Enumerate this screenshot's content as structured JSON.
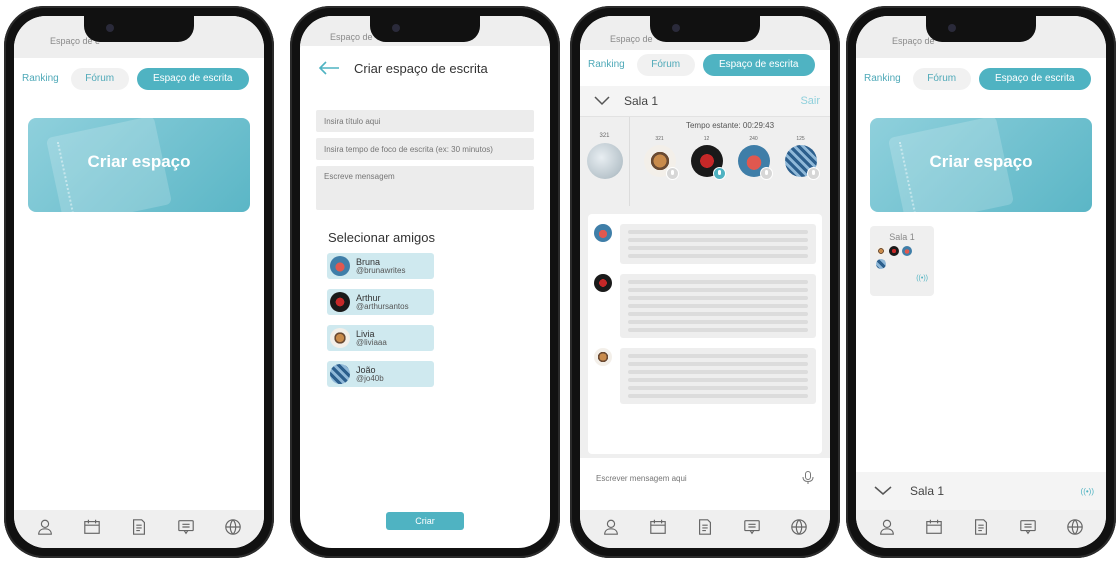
{
  "status": {
    "carrier_text": "Espaço de e",
    "carrier_text_short": "Espaço de"
  },
  "tabs": {
    "ranking": "Ranking",
    "forum": "Fórum",
    "writing_space": "Espaço de escrita"
  },
  "home": {
    "create_space_label": "Criar espaço"
  },
  "create": {
    "title": "Criar espaço de escrita",
    "title_placeholder": "Insira título aqui",
    "focus_placeholder": "Insira tempo de foco de escrita (ex: 30 minutos)",
    "message_placeholder": "Escreve mensagem",
    "select_friends": "Selecionar amigos",
    "friends": [
      {
        "name": "Bruna",
        "handle": "@brunawrites"
      },
      {
        "name": "Arthur",
        "handle": "@arthursantos"
      },
      {
        "name": "Livia",
        "handle": "@liviaaa"
      },
      {
        "name": "João",
        "handle": "@jo40b"
      }
    ],
    "create_button": "Criar"
  },
  "room": {
    "name": "Sala 1",
    "leave": "Sair",
    "timer": "Tempo estante: 00:29:43",
    "my_points": "321",
    "members": [
      {
        "points": "321",
        "mic": "off"
      },
      {
        "points": "12",
        "mic": "on"
      },
      {
        "points": "240",
        "mic": "off"
      },
      {
        "points": "125",
        "mic": "off"
      }
    ],
    "input_placeholder": "Escrever mensagem aqui"
  },
  "room_list": {
    "card_title": "Sala 1",
    "live_icon": "((•))"
  },
  "nav": {
    "items": [
      "profile-icon",
      "calendar-icon",
      "document-icon",
      "chat-icon",
      "globe-icon"
    ]
  },
  "colors": {
    "accent": "#4fb3c2",
    "light_accent": "#cfe9ef",
    "bar": "#efefef"
  }
}
